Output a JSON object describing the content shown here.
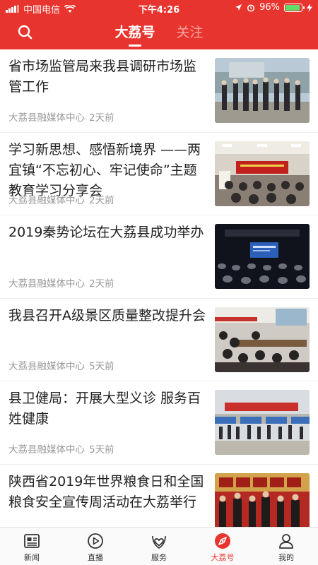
{
  "status_bar": {
    "carrier": "中国电信",
    "time": "下午4:26",
    "battery": "96%",
    "battery_level": 0.96
  },
  "header": {
    "tabs": [
      {
        "label": "大荔号",
        "active": true
      },
      {
        "label": "关注",
        "active": false
      }
    ],
    "accent": "#e8342e"
  },
  "feed": {
    "items": [
      {
        "title": "省市场监管局来我县调研市场监管工作",
        "source": "大荔县融媒体中心",
        "time": "2天前"
      },
      {
        "title": "学习新思想、感悟新境界 ——两宜镇“不忘初心、牢记使命”主题教育学习分享会",
        "source": "大荔县融媒体中心",
        "time": "2天前"
      },
      {
        "title": "2019秦势论坛在大荔县成功举办",
        "source": "大荔县融媒体中心",
        "time": "2天前"
      },
      {
        "title": "我县召开A级景区质量整改提升会",
        "source": "大荔县融媒体中心",
        "time": "5天前"
      },
      {
        "title": "县卫健局：开展大型义诊 服务百姓健康",
        "source": "大荔县融媒体中心",
        "time": "5天前"
      },
      {
        "title": "陕西省2019年世界粮食日和全国粮食安全宣传周活动在大荔举行",
        "source": "",
        "time": ""
      }
    ]
  },
  "bottom_nav": {
    "items": [
      {
        "label": "新闻",
        "icon": "newspaper-icon",
        "active": false
      },
      {
        "label": "直播",
        "icon": "play-icon",
        "active": false
      },
      {
        "label": "服务",
        "icon": "heart-hand-icon",
        "active": false
      },
      {
        "label": "大荔号",
        "icon": "compass-icon",
        "active": true
      },
      {
        "label": "我的",
        "icon": "person-icon",
        "active": false
      }
    ]
  }
}
